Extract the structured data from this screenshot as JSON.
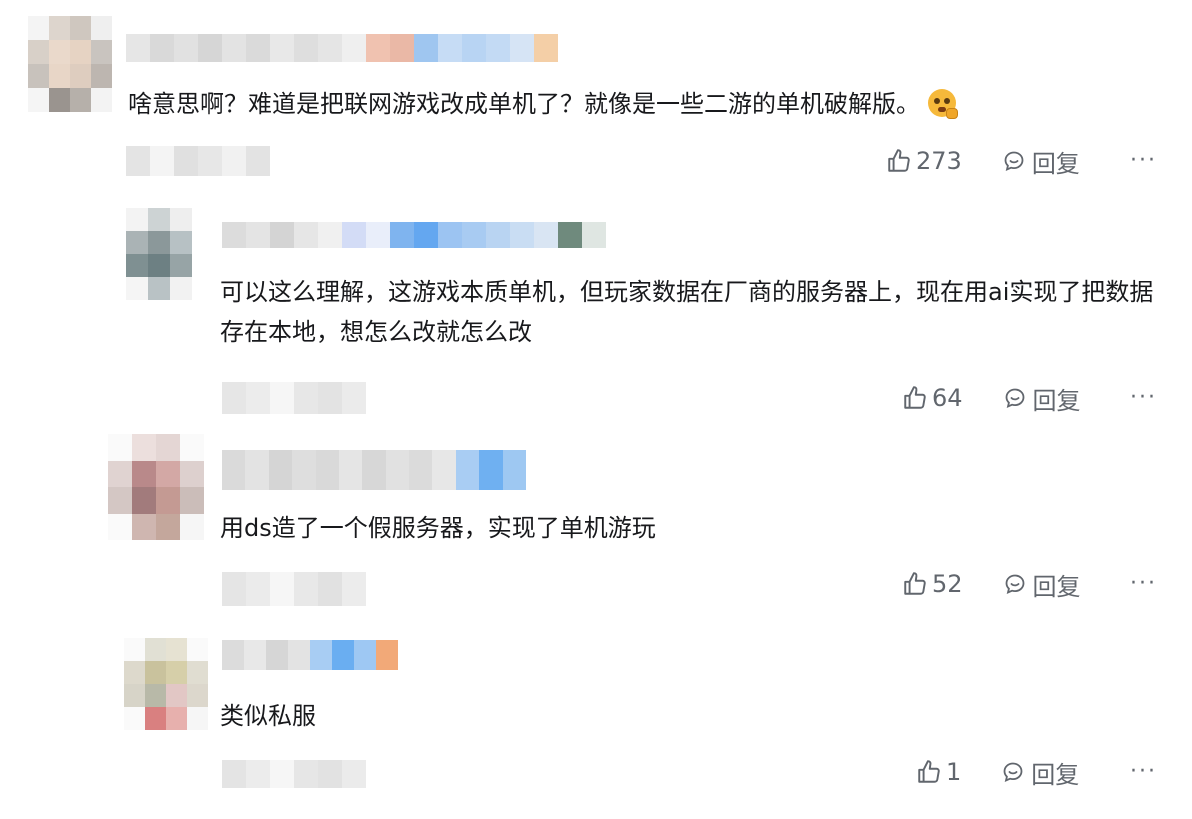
{
  "comments": [
    {
      "text": "啥意思啊？难道是把联网游戏改成单机了？就像是一些二游的单机破解版。",
      "emoji_icon": "thinking-face-emoji",
      "like_count": "273",
      "reply_label": "回复",
      "more_label": "···"
    }
  ],
  "replies": [
    {
      "text": "可以这么理解，这游戏本质单机，但玩家数据在厂商的服务器上，现在用ai实现了把数据存在本地，想怎么改就怎么改",
      "like_count": "64",
      "reply_label": "回复",
      "more_label": "···"
    },
    {
      "text": "用ds造了一个假服务器，实现了单机游玩",
      "like_count": "52",
      "reply_label": "回复",
      "more_label": "···"
    },
    {
      "text": "类似私服",
      "like_count": "1",
      "reply_label": "回复",
      "more_label": "···"
    }
  ],
  "icons": {
    "like": "thumbs-up-icon",
    "reply": "comment-bubble-icon",
    "more": "more-dots-icon"
  },
  "colors": {
    "text": "#18191c",
    "meta": "#61666d",
    "background": "#ffffff"
  }
}
